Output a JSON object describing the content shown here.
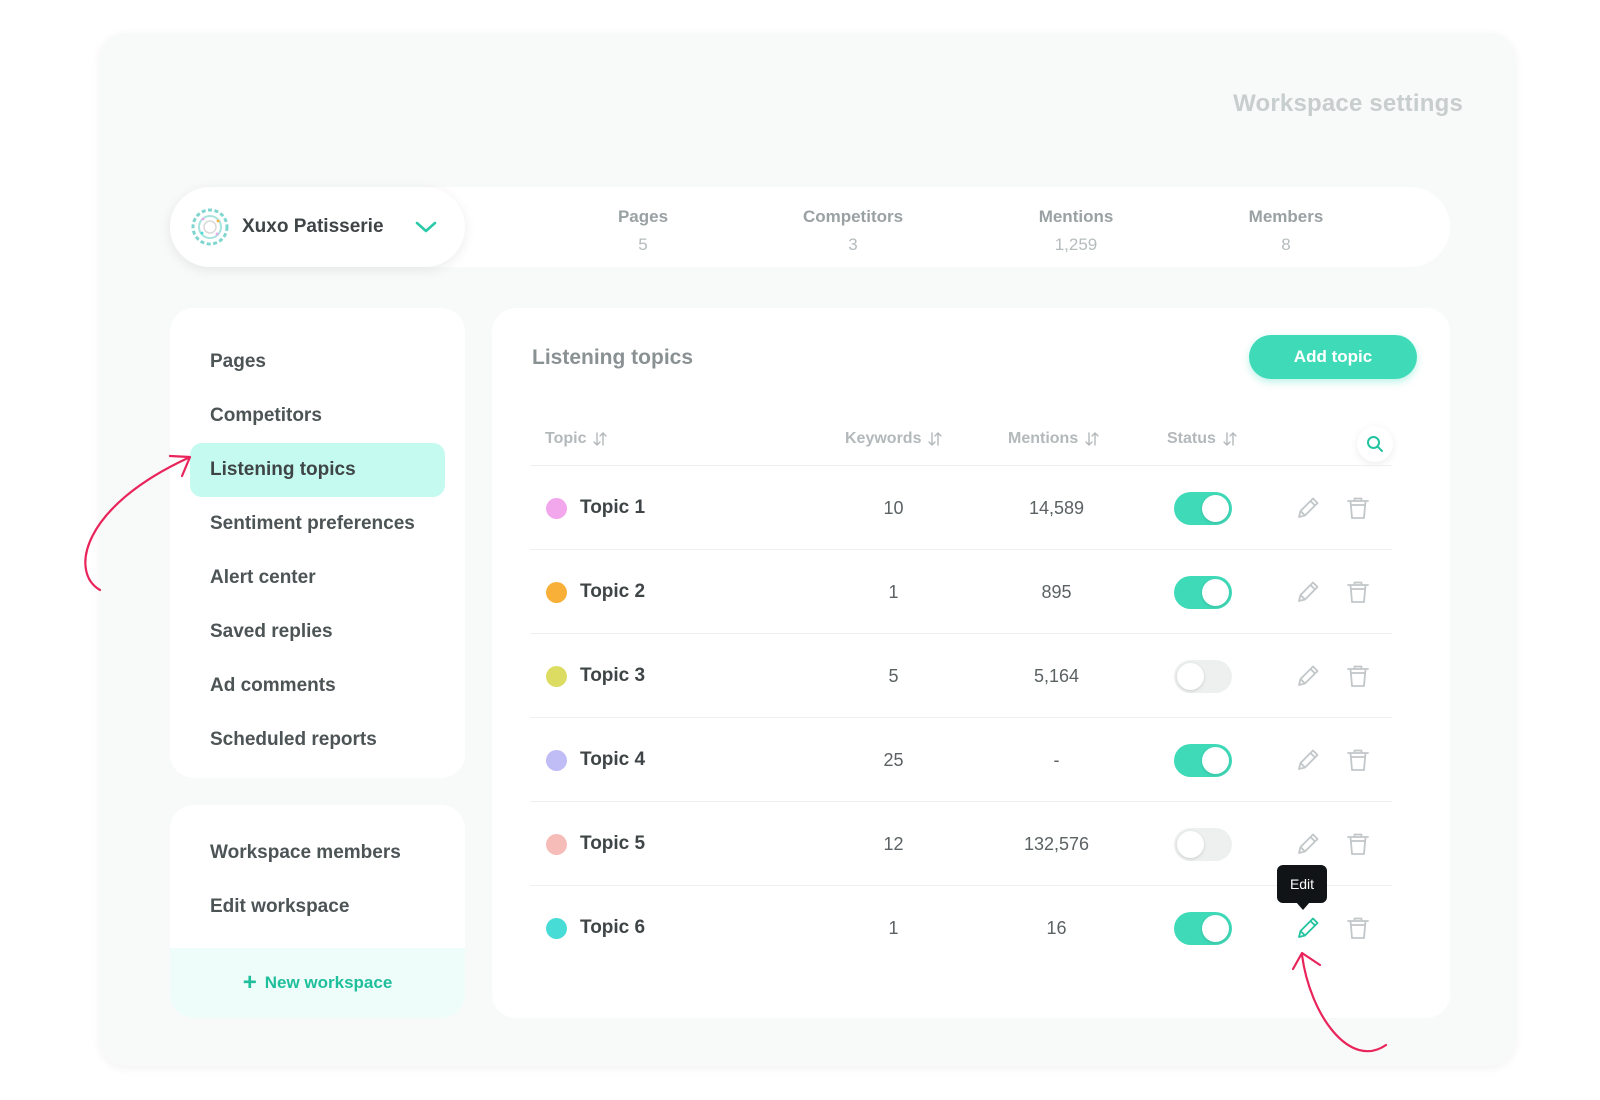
{
  "header": {
    "title": "Workspace settings"
  },
  "workspace": {
    "name": "Xuxo Patisserie"
  },
  "stats": [
    {
      "label": "Pages",
      "value": "5"
    },
    {
      "label": "Competitors",
      "value": "3"
    },
    {
      "label": "Mentions",
      "value": "1,259"
    },
    {
      "label": "Members",
      "value": "8"
    }
  ],
  "sidebar": {
    "items": [
      {
        "label": "Pages"
      },
      {
        "label": "Competitors"
      },
      {
        "label": "Listening topics",
        "active": true
      },
      {
        "label": "Sentiment preferences"
      },
      {
        "label": "Alert center"
      },
      {
        "label": "Saved replies"
      },
      {
        "label": "Ad comments"
      },
      {
        "label": "Scheduled reports"
      }
    ],
    "secondary": [
      {
        "label": "Workspace members"
      },
      {
        "label": "Edit workspace"
      }
    ],
    "new_workspace": "New workspace"
  },
  "main": {
    "title": "Listening topics",
    "add_button": "Add topic",
    "columns": [
      "Topic",
      "Keywords",
      "Mentions",
      "Status"
    ],
    "rows": [
      {
        "name": "Topic 1",
        "keywords": "10",
        "mentions": "14,589",
        "status": true,
        "color": "#f2a6ec"
      },
      {
        "name": "Topic 2",
        "keywords": "1",
        "mentions": "895",
        "status": true,
        "color": "#f8b038"
      },
      {
        "name": "Topic 3",
        "keywords": "5",
        "mentions": "5,164",
        "status": false,
        "color": "#dcdc62"
      },
      {
        "name": "Topic 4",
        "keywords": "25",
        "mentions": "-",
        "status": true,
        "color": "#bfbcf6"
      },
      {
        "name": "Topic 5",
        "keywords": "12",
        "mentions": "132,576",
        "status": false,
        "color": "#f6bcb8"
      },
      {
        "name": "Topic 6",
        "keywords": "1",
        "mentions": "16",
        "status": true,
        "color": "#48dcd6"
      }
    ],
    "tooltip": "Edit"
  },
  "colors": {
    "accent": "#3fdbb9",
    "active_bg": "#c5faf0",
    "annotation": "#e8245a"
  }
}
